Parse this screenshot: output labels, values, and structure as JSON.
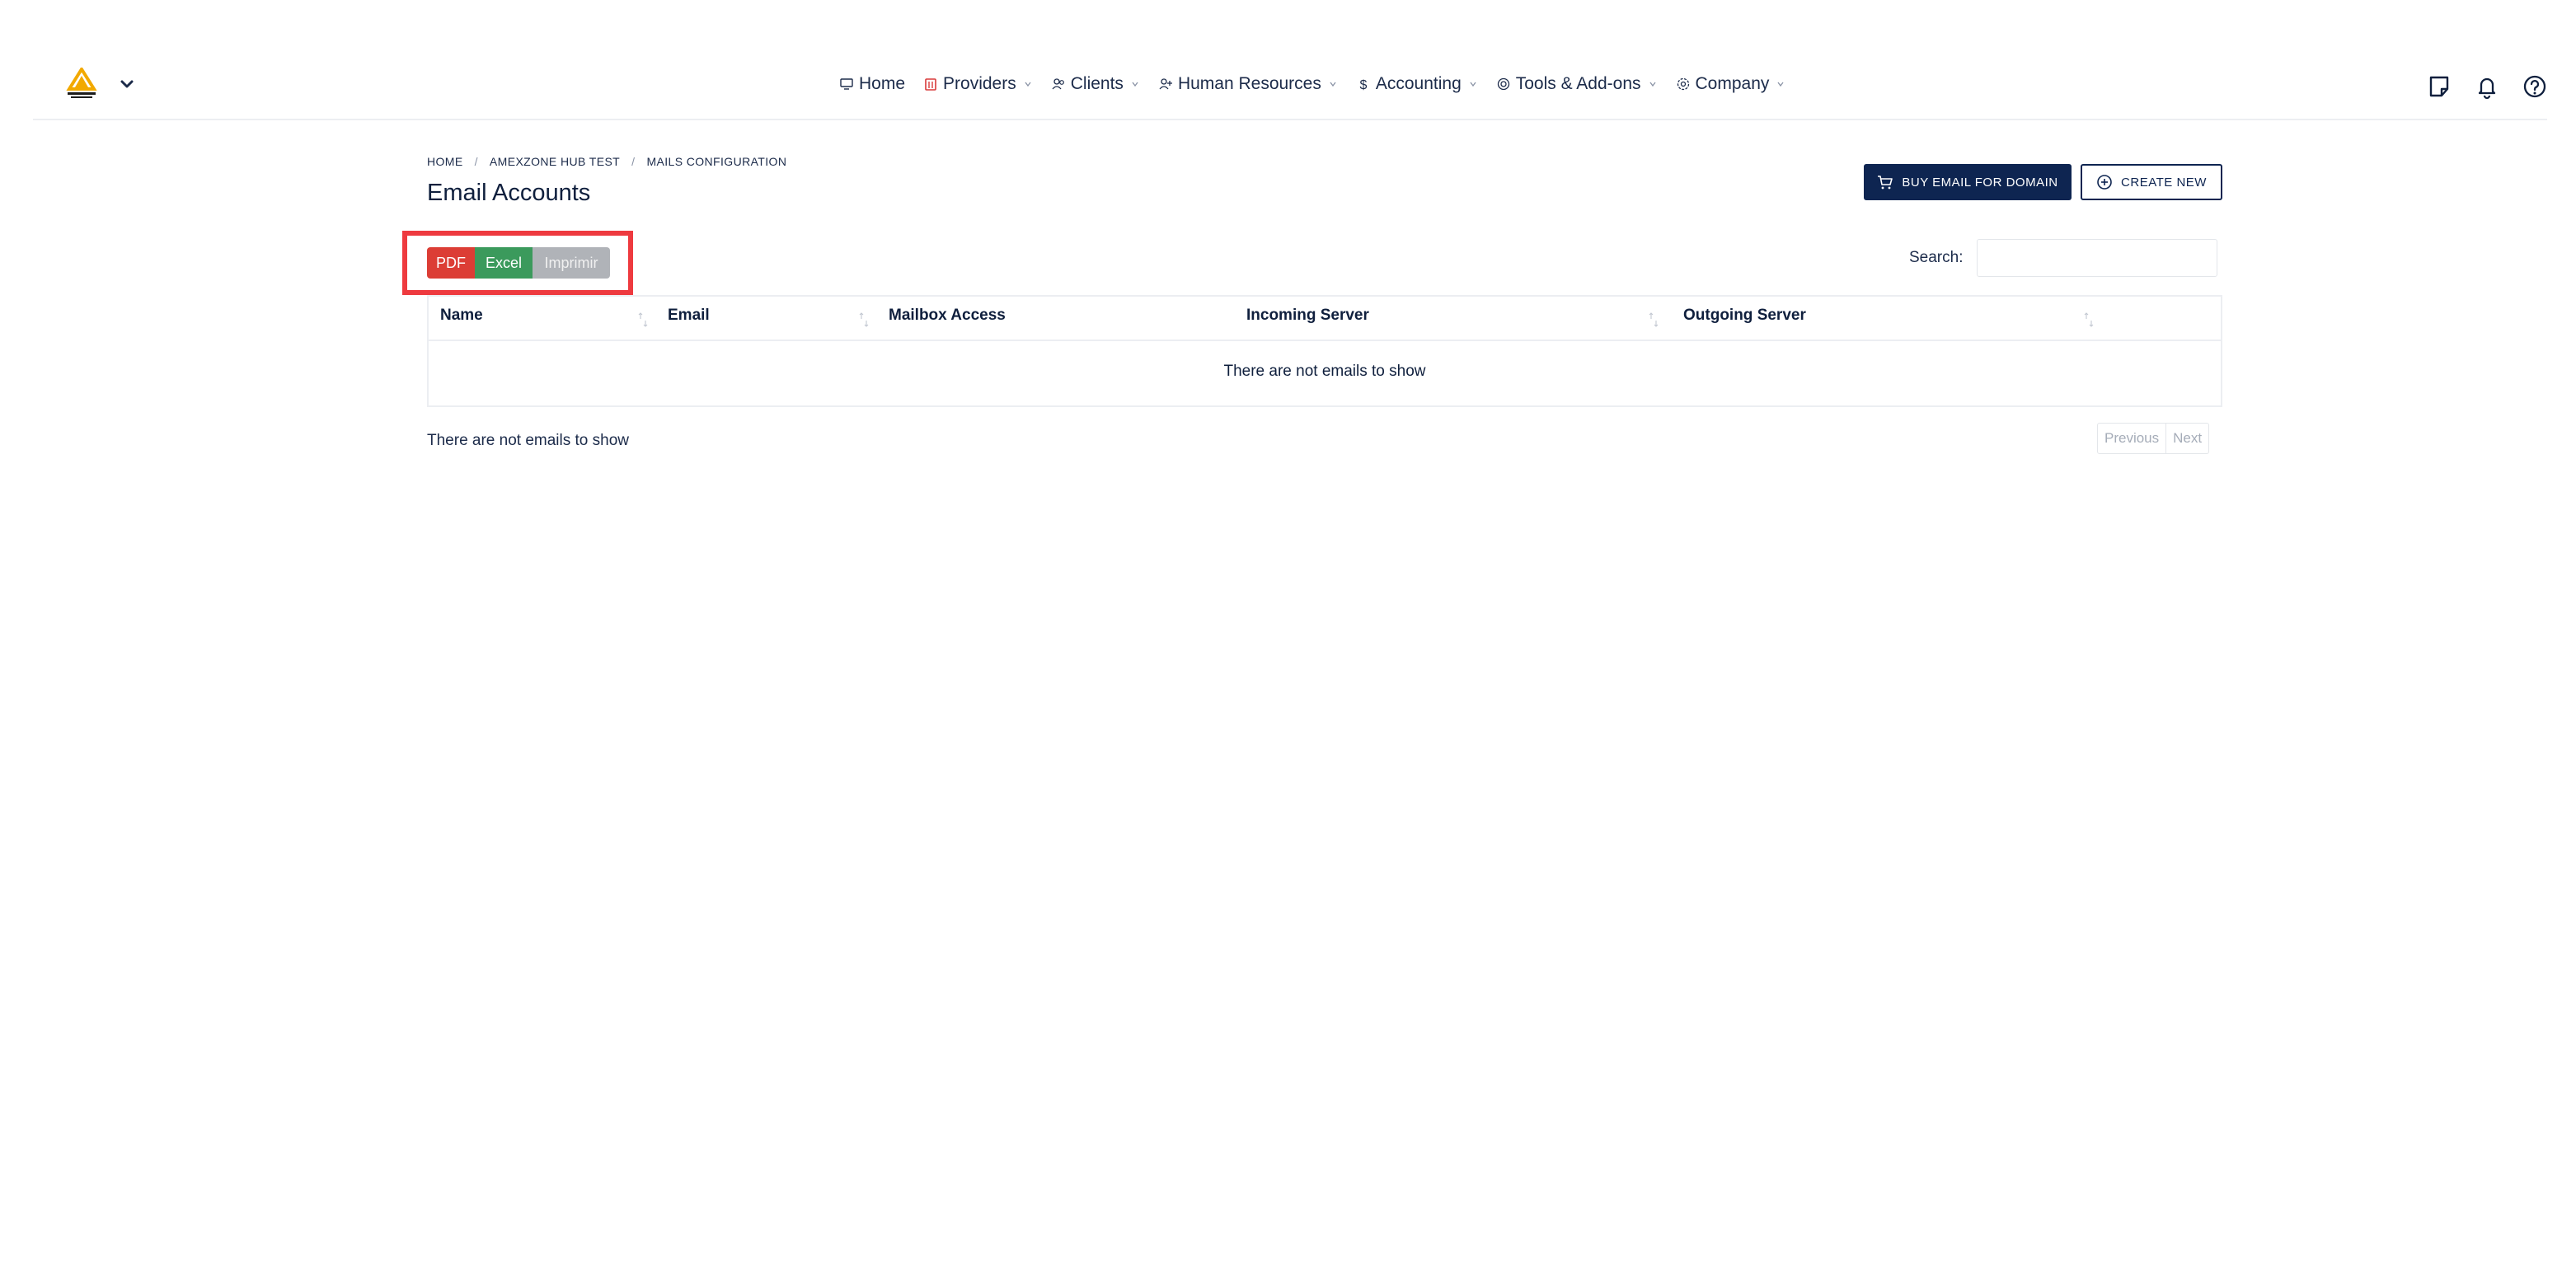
{
  "nav": {
    "items": [
      {
        "label": "Home",
        "icon": "monitor-icon",
        "has_dropdown": false
      },
      {
        "label": "Providers",
        "icon": "building-icon",
        "has_dropdown": true
      },
      {
        "label": "Clients",
        "icon": "users-icon",
        "has_dropdown": true
      },
      {
        "label": "Human Resources",
        "icon": "user-plus-icon",
        "has_dropdown": true
      },
      {
        "label": "Accounting",
        "icon": "dollar-icon",
        "has_dropdown": true
      },
      {
        "label": "Tools & Add-ons",
        "icon": "circle-icon",
        "has_dropdown": true
      },
      {
        "label": "Company",
        "icon": "gear-icon",
        "has_dropdown": true
      }
    ],
    "right_icons": [
      "note-icon",
      "bell-icon",
      "help-icon"
    ],
    "brand_color": "#f2a900"
  },
  "breadcrumb": [
    "HOME",
    "AMEXZONE HUB TEST",
    "MAILS CONFIGURATION"
  ],
  "page_title": "Email Accounts",
  "actions": {
    "buy_label": "BUY EMAIL FOR DOMAIN",
    "create_label": "CREATE NEW"
  },
  "export": {
    "pdf": "PDF",
    "excel": "Excel",
    "print": "Imprimir"
  },
  "search": {
    "label": "Search:",
    "value": ""
  },
  "table": {
    "columns": [
      "Name",
      "Email",
      "Mailbox Access",
      "Incoming Server",
      "Outgoing Server"
    ],
    "empty_message": "There are not emails to show"
  },
  "footer": {
    "info": "There are not emails to show",
    "previous": "Previous",
    "next": "Next"
  },
  "colors": {
    "primary": "#0e2551",
    "pdf": "#dc3d35",
    "excel": "#3b9a5c",
    "print": "#b0b3b8",
    "highlight": "#ee3a3f"
  }
}
